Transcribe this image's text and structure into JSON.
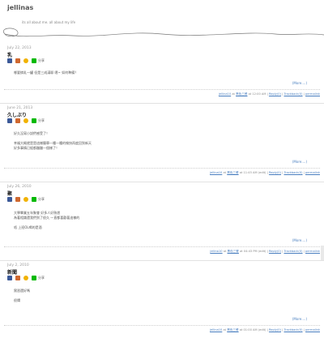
{
  "header": {
    "title": "jellinas",
    "subtitle": "its all about me. all about my life"
  },
  "share": {
    "label": "分享",
    "icons": [
      {
        "name": "facebook-icon",
        "color": "#3b5998"
      },
      {
        "name": "plurk-icon",
        "color": "#cf682f"
      },
      {
        "name": "emoticon-icon",
        "color": "#f1b200"
      },
      {
        "name": "line-icon",
        "color": "#00b900"
      }
    ]
  },
  "posts": [
    {
      "date": "July 22, 2013",
      "title": "乳",
      "lines": [
        "哪要擠乳一罐 但是三成滿耶 嗯~ 如何準備？"
      ],
      "more": "(More....)",
      "footer": {
        "author": "jellina10",
        "at": "at",
        "category": "黑色三餐",
        "time": "at 12:00 AM",
        "comments": "Reply(0)",
        "trackback": "Trackback(0)",
        "permalink": "permalink"
      }
    },
    {
      "date": "June 21, 2013",
      "title": "久しぶり",
      "lines": [
        "好久沒寫小說們感受了！",
        "",
        "幸福大概就是是這樣簡單一種一種的愉快再度回到新天",
        "好多事情已經都蹦蹦一個樣了！"
      ],
      "more": "(More....)",
      "footer": {
        "author": "jellina10",
        "at": "at",
        "category": "黑色三餐",
        "time": "at 11:45 AM (edit)",
        "comments": "Reply(0)",
        "trackback": "Trackback(0)",
        "permalink": "permalink"
      }
    },
    {
      "date": "July 26, 2010",
      "title": "聚",
      "lines": [
        "大學畢業五年聚會 好多人好熟悉",
        "為著相識還我們到了很久 一直都喜歡著這樣的",
        "",
        "唔 上班OL喝的是酒"
      ],
      "more": "(More....)",
      "footer": {
        "author": "jellina10",
        "at": "at",
        "category": "黑色三餐",
        "time": "at 04:43 PM (edit)",
        "comments": "Reply(0)",
        "trackback": "Trackback(0)",
        "permalink": "permalink"
      }
    },
    {
      "date": "July 2, 2010",
      "title": "新聞",
      "lines": [
        "實習還好嗎",
        "",
        "很爛"
      ],
      "more": "(More....)",
      "footer": {
        "author": "jellina10",
        "at": "at",
        "category": "黑色三餐",
        "time": "at 01:00 AM (edit)",
        "comments": "Reply(0)",
        "trackback": "Trackback(0)",
        "permalink": "permalink"
      }
    }
  ]
}
